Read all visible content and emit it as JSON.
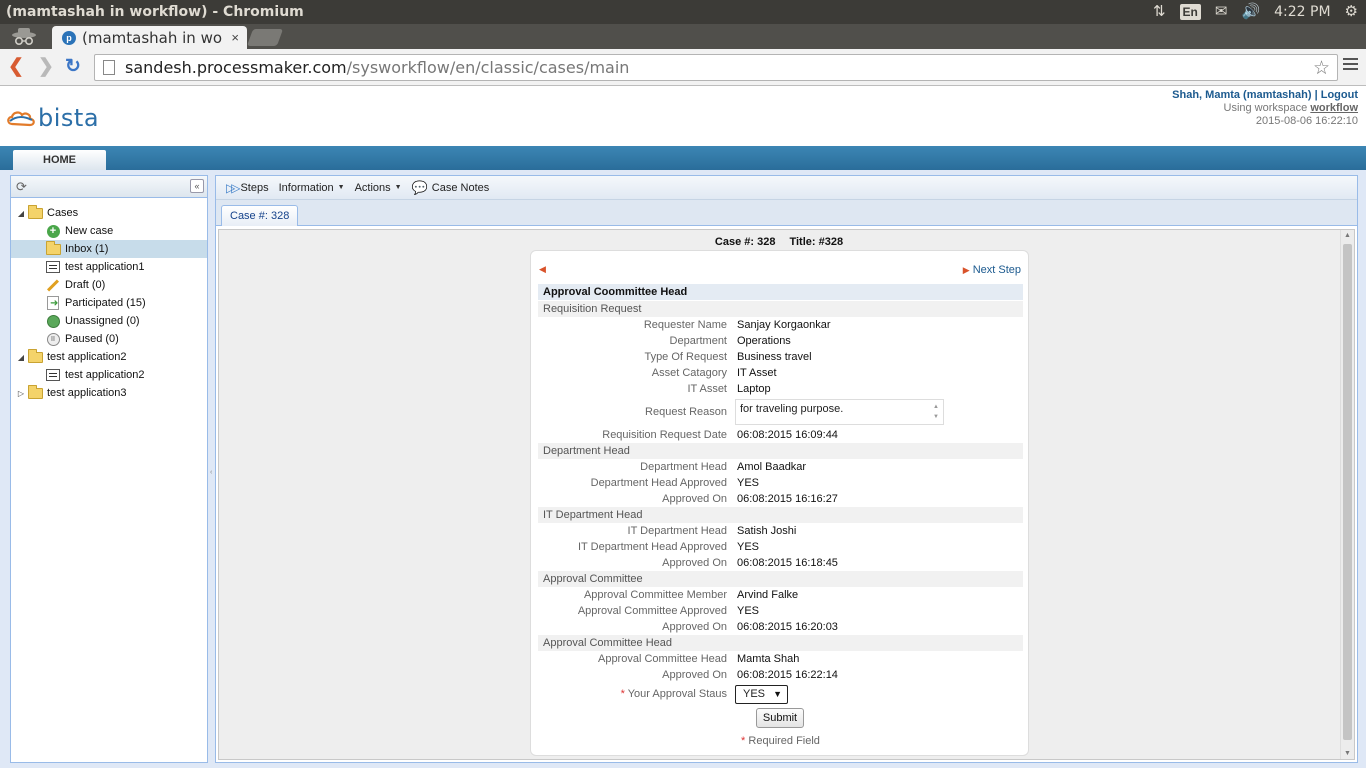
{
  "os": {
    "window_title": "(mamtashah in workflow) - Chromium",
    "keyboard": "En",
    "clock": "4:22 PM"
  },
  "browser": {
    "tab_title": "(mamtashah in wo",
    "tab_close": "×",
    "url_host": "sandesh.processmaker.com",
    "url_path": "/sysworkflow/en/classic/cases/main",
    "favicon_letter": "p"
  },
  "header": {
    "logo_text": "bista",
    "user_name": "Shah, Mamta (mamtashah)",
    "separator": "|",
    "logout": "Logout",
    "workspace_prefix": "Using workspace",
    "workspace": "workflow",
    "datetime": "2015-08-06 16:22:10"
  },
  "nav": {
    "home_tab": "HOME"
  },
  "tree": {
    "cases": "Cases",
    "items": [
      {
        "label": "New case",
        "icon": "new-case-icon"
      },
      {
        "label": "Inbox (1)",
        "icon": "inbox-icon"
      },
      {
        "label": "test application1",
        "icon": "form-icon"
      },
      {
        "label": "Draft (0)",
        "icon": "draft-icon"
      },
      {
        "label": "Participated (15)",
        "icon": "participated-icon"
      },
      {
        "label": "Unassigned (0)",
        "icon": "unassigned-icon"
      },
      {
        "label": "Paused (0)",
        "icon": "paused-icon"
      }
    ],
    "app2": "test application2",
    "app2_child": "test application2",
    "app3": "test application3"
  },
  "toolbar": {
    "steps": "Steps",
    "information": "Information",
    "actions": "Actions",
    "case_notes": "Case Notes"
  },
  "case_tab": "Case #: 328",
  "case_head": {
    "case": "Case #: 328",
    "title": "Title: #328"
  },
  "form": {
    "next_step": "Next Step",
    "title": "Approval Coommittee Head",
    "sections": {
      "requisition": "Requisition Request",
      "dept_head": "Department Head",
      "it_dept_head": "IT Department Head",
      "committee": "Approval Committee",
      "committee_head": "Approval Committee Head"
    },
    "fields": {
      "requester_name": {
        "label": "Requester Name",
        "value": "Sanjay Korgaonkar"
      },
      "department": {
        "label": "Department",
        "value": "Operations"
      },
      "type_of_request": {
        "label": "Type Of Request",
        "value": "Business travel"
      },
      "asset_category": {
        "label": "Asset Catagory",
        "value": "IT Asset"
      },
      "it_asset": {
        "label": "IT Asset",
        "value": "Laptop"
      },
      "request_reason": {
        "label": "Request Reason",
        "value": "for traveling purpose."
      },
      "req_date": {
        "label": "Requisition Request Date",
        "value": "06:08:2015 16:09:44"
      },
      "dept_head": {
        "label": "Department Head",
        "value": "Amol Baadkar"
      },
      "dept_head_approved": {
        "label": "Department Head Approved",
        "value": "YES"
      },
      "dept_approved_on": {
        "label": "Approved On",
        "value": "06:08:2015 16:16:27"
      },
      "it_head": {
        "label": "IT Department Head",
        "value": "Satish Joshi"
      },
      "it_head_approved": {
        "label": "IT Department Head Approved",
        "value": "YES"
      },
      "it_approved_on": {
        "label": "Approved On",
        "value": "06:08:2015 16:18:45"
      },
      "committee_member": {
        "label": "Approval Committee Member",
        "value": "Arvind Falke"
      },
      "committee_approved": {
        "label": "Approval Committee Approved",
        "value": "YES"
      },
      "committee_approved_on": {
        "label": "Approved On",
        "value": "06:08:2015 16:20:03"
      },
      "committee_head": {
        "label": "Approval Committee Head",
        "value": "Mamta Shah"
      },
      "committee_head_approved_on": {
        "label": "Approved On",
        "value": "06:08:2015 16:22:14"
      },
      "your_approval": {
        "label": "Your Approval Staus",
        "value": "YES",
        "required_mark": "*"
      }
    },
    "submit": "Submit",
    "required_mark": "*",
    "required_note": "Required Field"
  }
}
